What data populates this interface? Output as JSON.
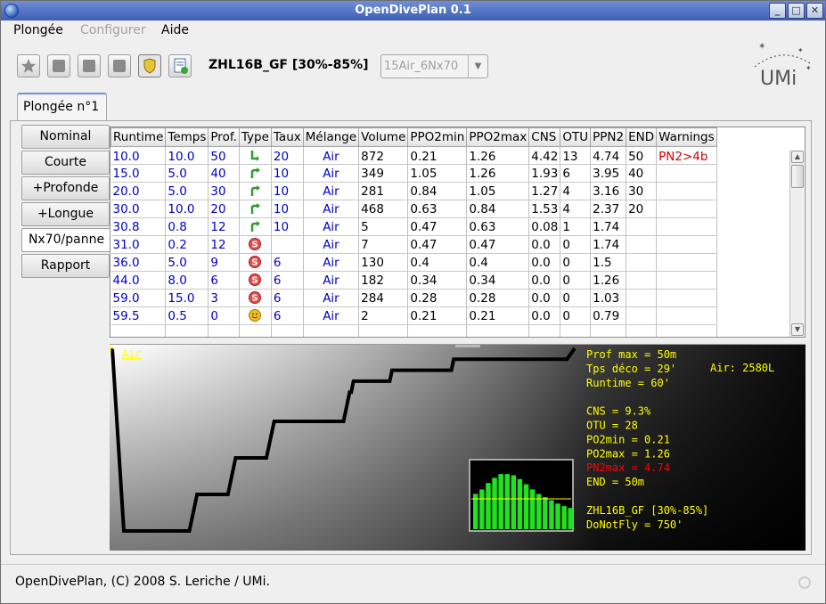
{
  "window": {
    "title": "OpenDivePlan 0.1"
  },
  "menu": [
    "Plongée",
    "Configurer",
    "Aide"
  ],
  "toolbar": {
    "icons": [
      "star-icon",
      "copy-plan-icon",
      "plan-icon",
      "plan-settings-icon",
      "shield-icon",
      "add-sheet-icon"
    ],
    "config_label": "ZHL16B_GF [30%-85%]",
    "mix_selected": "15Air_6Nx70"
  },
  "logo": {
    "text": "UMi"
  },
  "tab": "Plongée n°1",
  "sidebar": [
    "Nominal",
    "Courte",
    "+Profonde",
    "+Longue",
    "Nx70/panne",
    "Rapport"
  ],
  "table": {
    "columns": [
      "Runtime",
      "Temps",
      "Prof.",
      "Type",
      "Taux",
      "Mélange",
      "Volume",
      "PPO2min",
      "PPO2max",
      "CNS",
      "OTU",
      "PPN2",
      "END",
      "Warnings"
    ],
    "rows": [
      {
        "runtime": "10.0",
        "temps": "10.0",
        "prof": "50",
        "type": "descent",
        "taux": "20",
        "melange": "Air",
        "volume": "872",
        "ppo2min": "0.21",
        "ppo2max": "1.26",
        "cns": "4.42",
        "otu": "13",
        "ppn2": "4.74",
        "end": "50",
        "warn": "PN2>4b"
      },
      {
        "runtime": "15.0",
        "temps": "5.0",
        "prof": "40",
        "type": "ascent",
        "taux": "10",
        "melange": "Air",
        "volume": "349",
        "ppo2min": "1.05",
        "ppo2max": "1.26",
        "cns": "1.93",
        "otu": "6",
        "ppn2": "3.95",
        "end": "40",
        "warn": ""
      },
      {
        "runtime": "20.0",
        "temps": "5.0",
        "prof": "30",
        "type": "ascent",
        "taux": "10",
        "melange": "Air",
        "volume": "281",
        "ppo2min": "0.84",
        "ppo2max": "1.05",
        "cns": "1.27",
        "otu": "4",
        "ppn2": "3.16",
        "end": "30",
        "warn": ""
      },
      {
        "runtime": "30.0",
        "temps": "10.0",
        "prof": "20",
        "type": "ascent",
        "taux": "10",
        "melange": "Air",
        "volume": "468",
        "ppo2min": "0.63",
        "ppo2max": "0.84",
        "cns": "1.53",
        "otu": "4",
        "ppn2": "2.37",
        "end": "20",
        "warn": ""
      },
      {
        "runtime": "30.8",
        "temps": "0.8",
        "prof": "12",
        "type": "ascent",
        "taux": "10",
        "melange": "Air",
        "volume": "5",
        "ppo2min": "0.47",
        "ppo2max": "0.63",
        "cns": "0.08",
        "otu": "1",
        "ppn2": "1.74",
        "end": "",
        "warn": ""
      },
      {
        "runtime": "31.0",
        "temps": "0.2",
        "prof": "12",
        "type": "stop",
        "taux": "",
        "melange": "Air",
        "volume": "7",
        "ppo2min": "0.47",
        "ppo2max": "0.47",
        "cns": "0.0",
        "otu": "0",
        "ppn2": "1.74",
        "end": "",
        "warn": ""
      },
      {
        "runtime": "36.0",
        "temps": "5.0",
        "prof": "9",
        "type": "stop",
        "taux": "6",
        "melange": "Air",
        "volume": "130",
        "ppo2min": "0.4",
        "ppo2max": "0.4",
        "cns": "0.0",
        "otu": "0",
        "ppn2": "1.5",
        "end": "",
        "warn": ""
      },
      {
        "runtime": "44.0",
        "temps": "8.0",
        "prof": "6",
        "type": "stop",
        "taux": "6",
        "melange": "Air",
        "volume": "182",
        "ppo2min": "0.34",
        "ppo2max": "0.34",
        "cns": "0.0",
        "otu": "0",
        "ppn2": "1.26",
        "end": "",
        "warn": ""
      },
      {
        "runtime": "59.0",
        "temps": "15.0",
        "prof": "3",
        "type": "stop",
        "taux": "6",
        "melange": "Air",
        "volume": "284",
        "ppo2min": "0.28",
        "ppo2max": "0.28",
        "cns": "0.0",
        "otu": "0",
        "ppn2": "1.03",
        "end": "",
        "warn": ""
      },
      {
        "runtime": "59.5",
        "temps": "0.5",
        "prof": "0",
        "type": "surface",
        "taux": "6",
        "melange": "Air",
        "volume": "2",
        "ppo2min": "0.21",
        "ppo2max": "0.21",
        "cns": "0.0",
        "otu": "0",
        "ppn2": "0.79",
        "end": "",
        "warn": ""
      }
    ]
  },
  "profile": {
    "gas_label": "Air",
    "stats": [
      {
        "text": "Prof max = 50m",
        "color": "#ffff00"
      },
      {
        "text": "Tps déco = 29'",
        "color": "#ffff00"
      },
      {
        "text": "Runtime = 60'",
        "color": "#ffff00"
      },
      {
        "text": "",
        "color": "#ffff00"
      },
      {
        "text": "CNS = 9.3%",
        "color": "#ffff00"
      },
      {
        "text": "OTU = 28",
        "color": "#ffff00"
      },
      {
        "text": "PO2min = 0.21",
        "color": "#ffff00"
      },
      {
        "text": "PO2max = 1.26",
        "color": "#ffff00"
      },
      {
        "text": "PN2max = 4.74",
        "color": "#ff0000"
      },
      {
        "text": "END = 50m",
        "color": "#ffff00"
      },
      {
        "text": "",
        "color": "#ffff00"
      },
      {
        "text": "ZHL16B_GF [30%-85%]",
        "color": "#ffff00"
      },
      {
        "text": "DoNotFly = 750'",
        "color": "#ffff00"
      }
    ],
    "air_label": "Air: 2580L",
    "profile_points": [
      [
        0,
        0
      ],
      [
        1.5,
        50
      ],
      [
        10,
        50
      ],
      [
        11,
        40
      ],
      [
        15,
        40
      ],
      [
        16,
        30
      ],
      [
        20,
        30
      ],
      [
        21,
        20
      ],
      [
        30,
        20
      ],
      [
        30.8,
        12
      ],
      [
        31,
        12
      ],
      [
        31.3,
        9
      ],
      [
        36,
        9
      ],
      [
        36.3,
        6
      ],
      [
        44,
        6
      ],
      [
        44.3,
        3
      ],
      [
        59,
        3
      ],
      [
        60,
        0
      ]
    ],
    "tissue_bars": [
      0.55,
      0.62,
      0.72,
      0.8,
      0.86,
      0.86,
      0.84,
      0.78,
      0.7,
      0.62,
      0.55,
      0.5,
      0.45,
      0.4,
      0.36,
      0.33
    ]
  },
  "status": "OpenDivePlan, (C) 2008 S. Leriche / UMi."
}
